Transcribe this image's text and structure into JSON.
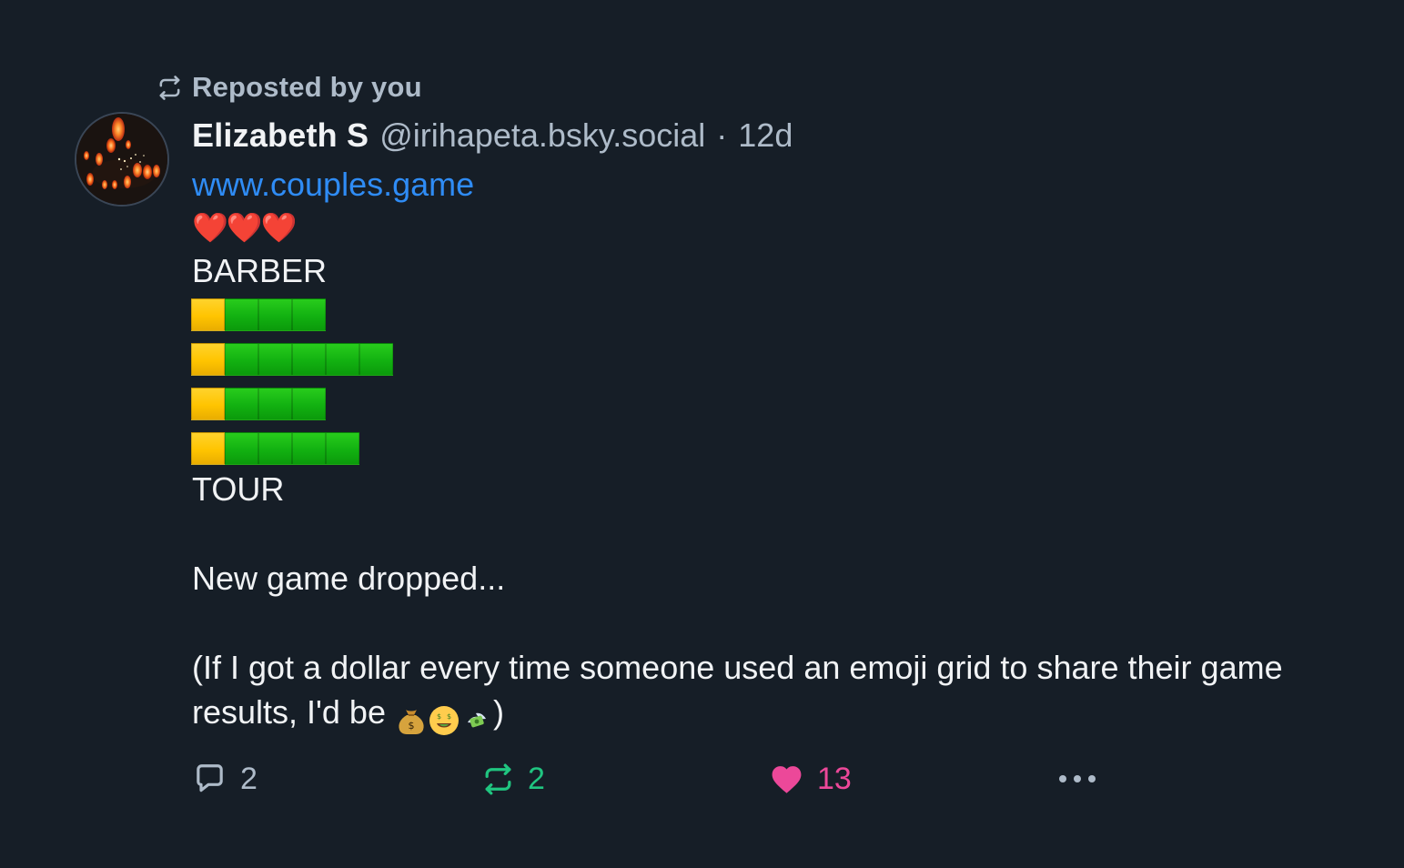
{
  "repost_banner": {
    "label": "Reposted by you",
    "icon": "repost-icon"
  },
  "post": {
    "author_display_name": "Elizabeth S",
    "author_handle": "@irihapeta.bsky.social",
    "separator": "·",
    "timestamp": "12d",
    "link_text": "www.couples.game",
    "hearts": "❤️❤️❤️",
    "top_word": "BARBER",
    "grid": [
      [
        "yellow",
        "green",
        "green",
        "green"
      ],
      [
        "yellow",
        "green",
        "green",
        "green",
        "green",
        "green"
      ],
      [
        "yellow",
        "green",
        "green",
        "green"
      ],
      [
        "yellow",
        "green",
        "green",
        "green",
        "green"
      ]
    ],
    "bottom_word": "TOUR",
    "paragraph_1": "New game dropped...",
    "paragraph_2_prefix": "(If I got a dollar every time someone used an emoji grid to share their game results, I'd be ",
    "paragraph_2_suffix": ")",
    "paragraph_2_emojis": [
      "money-bag",
      "money-mouth-face",
      "money-with-wings"
    ]
  },
  "actions": {
    "reply": {
      "count": "2",
      "icon": "reply-icon"
    },
    "repost": {
      "count": "2",
      "icon": "repost-icon"
    },
    "like": {
      "count": "13",
      "icon": "heart-icon"
    },
    "more": {
      "icon": "more-icon"
    }
  },
  "colors": {
    "background": "#161e27",
    "text": "#f1f3f5",
    "muted": "#aebbc9",
    "link": "#2f8cf5",
    "repost_active": "#20c580",
    "like_active": "#ec4899",
    "grid_yellow": "#ffc400",
    "grid_green": "#12b111"
  }
}
